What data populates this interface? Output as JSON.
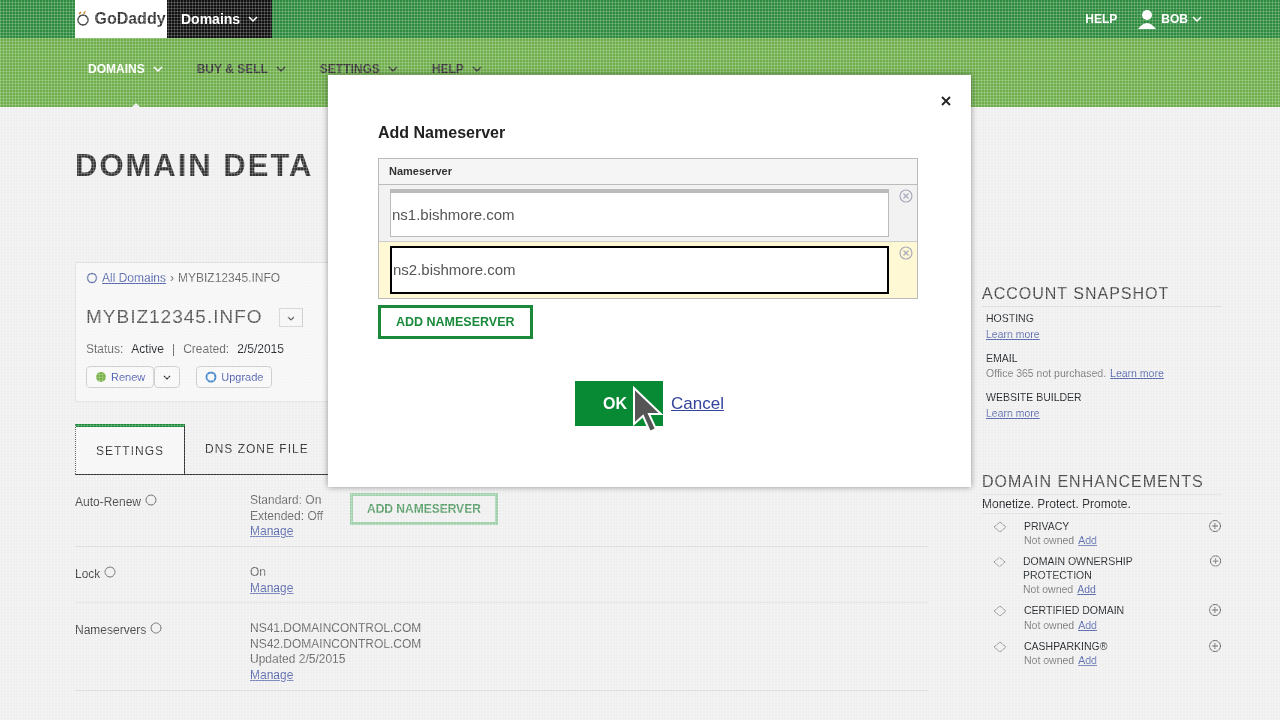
{
  "header": {
    "logo": "GoDaddy",
    "product_menu": "Domains",
    "help": "HELP",
    "user": "BOB"
  },
  "nav": [
    {
      "label": "DOMAINS",
      "selected": true
    },
    {
      "label": "BUY & SELL",
      "selected": false
    },
    {
      "label": "SETTINGS",
      "selected": false
    },
    {
      "label": "HELP",
      "selected": false
    }
  ],
  "page": {
    "title": "DOMAIN DETA",
    "breadcrumb": {
      "link": "All Domains",
      "separator": "›",
      "current": "MYBIZ12345.INFO"
    },
    "domain": "MYBIZ12345.INFO",
    "status_separator": "|",
    "status": [
      {
        "label": "Status:",
        "value": "Active"
      },
      {
        "label": "Created:",
        "value": "2/5/2015"
      }
    ],
    "actions": [
      {
        "label": "Renew",
        "dropdown": true
      },
      {
        "label": "Upgrade",
        "dropdown": false
      }
    ],
    "tabs": [
      {
        "label": "SETTINGS",
        "selected": true
      },
      {
        "label": "DNS ZONE FILE",
        "selected": false
      }
    ],
    "settings": [
      {
        "label": "Auto-Renew",
        "lines": [
          "Standard: On",
          "Extended: Off"
        ],
        "link": "Manage"
      },
      {
        "label": "Lock",
        "lines": [
          "On"
        ],
        "link": "Manage"
      },
      {
        "label": "Nameservers",
        "lines": [
          "NS41.DOMAINCONTROL.COM",
          "NS42.DOMAINCONTROL.COM",
          "Updated 2/5/2015"
        ],
        "link": "Manage"
      }
    ],
    "ghost_button": "ADD NAMESERVER"
  },
  "snapshot": {
    "title": "ACCOUNT SNAPSHOT",
    "items": [
      {
        "label": "HOSTING",
        "link": "Learn more"
      },
      {
        "label": "EMAIL",
        "text": "Office 365 not purchased.",
        "link": "Learn more"
      },
      {
        "label": "WEBSITE BUILDER",
        "link": "Learn more"
      }
    ]
  },
  "enhancements": {
    "title": "DOMAIN ENHANCEMENTS",
    "subtitle": "Monetize. Protect. Promote.",
    "items": [
      {
        "name": "PRIVACY",
        "status": "Not owned",
        "link": "Add"
      },
      {
        "name": "DOMAIN OWNERSHIP PROTECTION",
        "status": "Not owned",
        "link": "Add"
      },
      {
        "name": "CERTIFIED DOMAIN",
        "status": "Not owned",
        "link": "Add"
      },
      {
        "name": "CASHPARKING®",
        "status": "Not owned",
        "link": "Add"
      }
    ]
  },
  "dialog": {
    "title": "Add Nameserver",
    "column": "Nameserver",
    "rows": [
      {
        "value": "ns1.bishmore.com",
        "selected": false
      },
      {
        "value": "ns2.bishmore.com",
        "selected": true
      }
    ],
    "add_button": "ADD NAMESERVER",
    "ok": "OK",
    "cancel": "Cancel"
  }
}
